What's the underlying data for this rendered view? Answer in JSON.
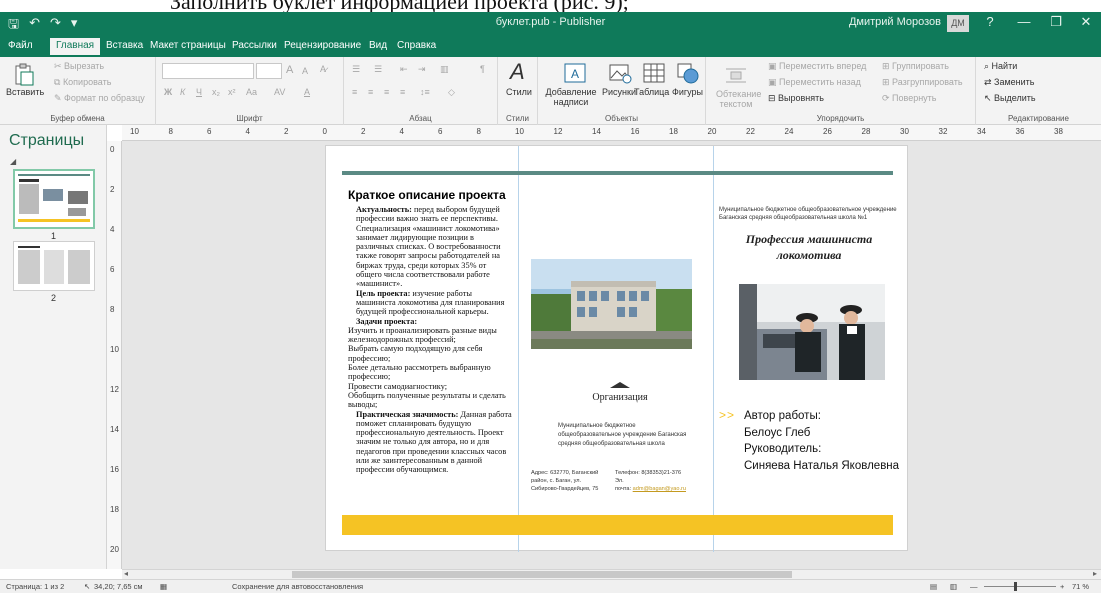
{
  "caption": "Заполнить буклет информацией проекта (рис. 9);",
  "titlebar": {
    "doc_title": "буклет.pub  -  Publisher",
    "user_name": "Дмитрий Морозов",
    "avatar_initials": "ДМ",
    "help": "?",
    "minimize": "—",
    "restore": "❐",
    "close": "✕"
  },
  "tabs": [
    "Файл",
    "Главная",
    "Вставка",
    "Макет страницы",
    "Рассылки",
    "Рецензирование",
    "Вид",
    "Справка"
  ],
  "ribbon": {
    "clipboard": {
      "paste": "Вставить",
      "cut": "Вырезать",
      "copy": "Копировать",
      "format_painter": "Формат по образцу",
      "label": "Буфер обмена"
    },
    "font": {
      "label": "Шрифт",
      "grow": "A",
      "shrink": "A",
      "bold": "Ж",
      "italic": "К",
      "underline": "Ч",
      "change_case": "Aa",
      "spacing": "AV",
      "color": "A"
    },
    "paragraph": {
      "label": "Абзац",
      "marks": "¶"
    },
    "styles": {
      "button": "Стили",
      "label": "Стили"
    },
    "objects": {
      "label": "Объекты",
      "textbox": "Добавление надписи",
      "pictures": "Рисунки",
      "table": "Таблица",
      "shapes": "Фигуры"
    },
    "arrange": {
      "label": "Упорядочить",
      "wrap": "Обтекание текстом",
      "bring_forward": "Переместить вперед",
      "send_backward": "Переместить назад",
      "align": "Выровнять",
      "group": "Группировать",
      "ungroup": "Разгруппировать",
      "rotate": "Повернуть"
    },
    "editing": {
      "label": "Редактирование",
      "find": "Найти",
      "replace": "Заменить",
      "select": "Выделить"
    }
  },
  "pages_pane": {
    "title": "Страницы",
    "pages": [
      "1",
      "2"
    ]
  },
  "ruler": {
    "h_ticks": [
      "10",
      "8",
      "6",
      "4",
      "2",
      "0",
      "2",
      "4",
      "6",
      "8",
      "10",
      "12",
      "14",
      "16",
      "18",
      "20",
      "22",
      "24",
      "26",
      "28",
      "30",
      "32",
      "34",
      "36",
      "38"
    ],
    "v_ticks": [
      "0",
      "2",
      "4",
      "6",
      "8",
      "10",
      "12",
      "14",
      "16",
      "18",
      "20"
    ]
  },
  "booklet": {
    "heading": "Краткое описание проекта",
    "p1_bold": "Актуальность:",
    "p1": " перед выбором будущей профессии важно знать ее перспективы. Специализация «машинист локомотива» занимает лидирующие позиции в различных списках. О востребованности также говорят запросы работодателей на биржах труда, среди которых 35% от общего числа соответствовали работе «машинист».",
    "p2_bold": "Цель проекта:",
    "p2": " изучение работы машиниста локомотива для планирования будущей профессиональной карьеры.",
    "tasks_title": "Задачи проекта:",
    "tasks": [
      "Изучить и проанализировать разные виды железнодорожных профессий;",
      "Выбрать самую подходящую для себя профессию;",
      "Более детально рассмотреть выбранную профессию;",
      "Провести самодиагностику;",
      "Обобщить полученные результаты и сделать выводы;"
    ],
    "p3_bold": "Практическая значимость:",
    "p3": " Данная работа поможет спланировать будущую профессиональную деятельность. Проект значим не только для автора, но и для педагогов при проведении классных часов или же заинтересованным в данной профессии обучающимся.",
    "org_title": "Организация",
    "org_name": "Муниципальное бюджетное общеобразовательное учреждение Баганская средняя общеобразовательная школа",
    "address": "Адрес: 632770, Баганский район, с. Баган, ул. Сибирово-Гвардейцев, 75",
    "phone": "Телефон: 8(38353)21-376",
    "phone_ext": "Эл.",
    "mail_label": "почта:",
    "mail": "adm@bagan@yao.ru",
    "school": "Муниципальное бюджетное общеобразовательное учреждение Баганская средняя общеобразовательная школа №1",
    "title": "Профессия машиниста локомотива",
    "arrows": ">>",
    "author_label": "Автор работы:",
    "author": "Белоус Глеб",
    "supervisor_label": "Руководитель:",
    "supervisor": "Синяева Наталья Яковлевна"
  },
  "status": {
    "page": "Страница: 1 из 2",
    "position": "34,20; 7,65 см",
    "autosave": "Сохранение для автовосстановления",
    "zoom_minus": "—",
    "zoom_plus": "+",
    "zoom": "71 %"
  },
  "colors": {
    "accent": "#0f7a5a",
    "yellow": "#f5c324",
    "teal_bar": "#5b8a84"
  }
}
